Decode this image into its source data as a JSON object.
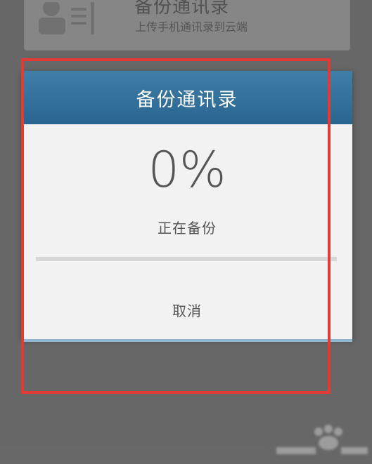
{
  "background": {
    "card_title": "备份通讯录",
    "card_subtitle": "上传手机通讯录到云端",
    "card_icon": "contact-card-icon"
  },
  "dialog": {
    "title": "备份通讯录",
    "percent": "0%",
    "progress_fraction": 0,
    "status": "正在备份",
    "cancel_label": "取消"
  },
  "colors": {
    "header": "#2f6e99",
    "highlight": "#e23b35",
    "overlay": "#7b7b7b"
  }
}
